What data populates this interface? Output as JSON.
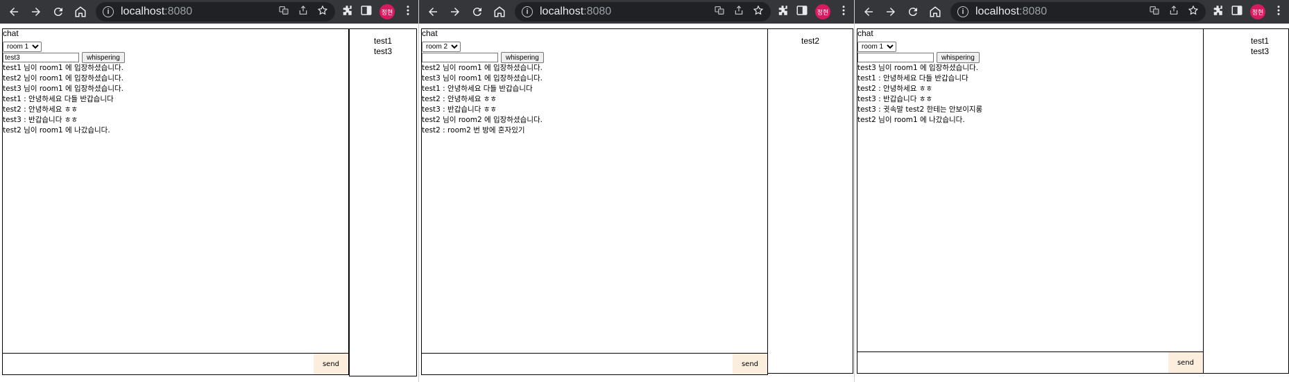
{
  "browser": {
    "address_host": "localhost",
    "address_port": ":8080",
    "profile_initials": "정현",
    "toolbar_color": "#35363a",
    "omnibox_color": "#202124",
    "profile_color": "#d81b60",
    "icons": [
      "back-icon",
      "forward-icon",
      "reload-icon",
      "home-icon",
      "info-icon",
      "translate-icon",
      "share-icon",
      "bookmark-star-icon",
      "extensions-icon",
      "side-panel-icon",
      "menu-icon"
    ]
  },
  "windows": [
    {
      "chat_title": "chat",
      "room_select": "room 1",
      "whisper_value": "test3",
      "whisper_button": "whispering",
      "messages": [
        "test1 님이 room1 에 입장하셨습니다.",
        "test2 님이 room1 에 입장하셨습니다.",
        "test3 님이 room1 에 입장하셨습니다.",
        "test1 : 안녕하세요 다들 반갑습니다",
        "test2 : 안녕하세요 ㅎㅎ",
        "test3 : 반갑습니다 ㅎㅎ",
        "test2 님이 room1 에 나갔습니다."
      ],
      "send_label": "send",
      "users": [
        "test1",
        "test3"
      ]
    },
    {
      "chat_title": "chat",
      "room_select": "room 2",
      "whisper_value": "",
      "whisper_button": "whispering",
      "messages": [
        "test2 님이 room1 에 입장하셨습니다.",
        "test3 님이 room1 에 입장하셨습니다.",
        "test1 : 안녕하세요 다들 반갑습니다",
        "test2 : 안녕하세요 ㅎㅎ",
        "test3 : 반갑습니다 ㅎㅎ",
        "test2 님이 room2 에 입장하셨습니다.",
        "test2 : room2 번 방에 혼자있기"
      ],
      "send_label": "send",
      "users": [
        "test2"
      ]
    },
    {
      "chat_title": "chat",
      "room_select": "room 1",
      "whisper_value": "",
      "whisper_button": "whispering",
      "messages": [
        "test3 님이 room1 에 입장하셨습니다.",
        "test1 : 안녕하세요 다들 반갑습니다",
        "test2 : 안녕하세요 ㅎㅎ",
        "test3 : 반갑습니다 ㅎㅎ",
        "test3 : 귓속말 test2 한테는 안보이지롱",
        "test2 님이 room1 에 나갔습니다."
      ],
      "send_label": "send",
      "users": [
        "test1",
        "test3"
      ]
    }
  ]
}
